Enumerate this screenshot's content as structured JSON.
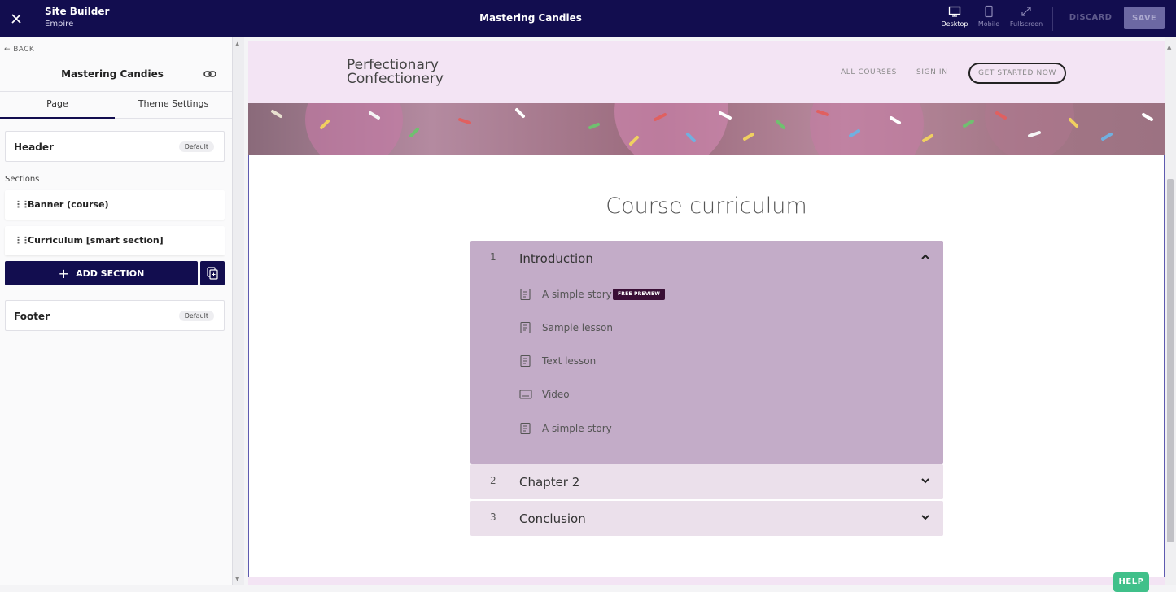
{
  "topbar": {
    "app_title": "Site Builder",
    "app_subtitle": "Empire",
    "page_name": "Mastering Candies",
    "views": {
      "desktop": "Desktop",
      "mobile": "Mobile",
      "fullscreen": "Fullscreen"
    },
    "discard_label": "DISCARD",
    "save_label": "SAVE",
    "close_icon": "close-icon"
  },
  "sidebar": {
    "back_label": "BACK",
    "title": "Mastering Candies",
    "tabs": [
      {
        "label": "Page"
      },
      {
        "label": "Theme Settings"
      }
    ],
    "header": {
      "label": "Header",
      "badge": "Default"
    },
    "sections_label": "Sections",
    "sections": [
      {
        "label": "Banner (course)"
      },
      {
        "label": "Curriculum [smart section]"
      }
    ],
    "add_section_label": "ADD SECTION",
    "footer": {
      "label": "Footer",
      "badge": "Default"
    }
  },
  "site": {
    "logo_line1": "Perfectionary",
    "logo_line2": "Confectionery",
    "nav": {
      "all_courses": "ALL COURSES",
      "sign_in": "SIGN IN",
      "cta": "GET STARTED NOW"
    },
    "curriculum_title": "Course curriculum",
    "chapters": [
      {
        "number": "1",
        "title": "Introduction",
        "expanded": true,
        "lessons": [
          {
            "title": "A simple story",
            "icon": "text-lesson-icon",
            "badge": "FREE PREVIEW"
          },
          {
            "title": "Sample lesson",
            "icon": "text-lesson-icon"
          },
          {
            "title": "Text lesson",
            "icon": "text-lesson-icon"
          },
          {
            "title": "Video",
            "icon": "video-lesson-icon"
          },
          {
            "title": "A simple story",
            "icon": "text-lesson-icon"
          }
        ]
      },
      {
        "number": "2",
        "title": "Chapter 2",
        "expanded": false
      },
      {
        "number": "3",
        "title": "Conclusion",
        "expanded": false
      }
    ]
  },
  "help_label": "HELP",
  "colors": {
    "topbar_bg": "#120d4f",
    "primary_button": "#120d4f",
    "site_bg": "#f3e4f4",
    "chapter_expanded_bg": "#c3acc8",
    "chapter_collapsed_bg": "#ebe0eb",
    "free_preview_badge": "#3a0f36",
    "help_button": "#40c08a"
  }
}
